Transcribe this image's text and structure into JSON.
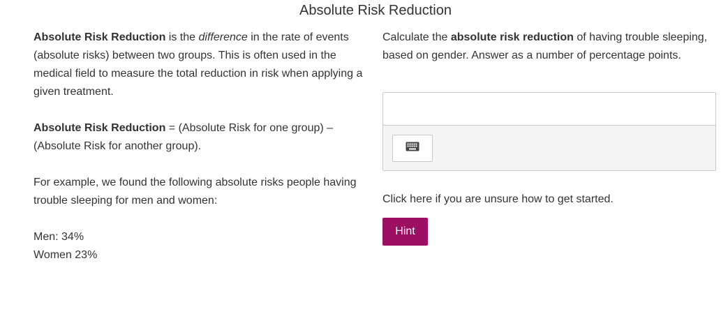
{
  "page": {
    "title": "Absolute Risk Reduction"
  },
  "left": {
    "p1": {
      "term": "Absolute Risk Reduction",
      "t1": " is the ",
      "em": "difference",
      "t2": " in the rate of events (absolute risks) between two groups. This is often used in the medical field to measure the total reduction in risk when applying a given treatment."
    },
    "p2": {
      "term": "Absolute Risk Reduction",
      "formula": " = (Absolute Risk for one group) – (Absolute Risk for another group)."
    },
    "p3": "For example, we found the following absolute risks people having trouble sleeping for men and women:",
    "risks": [
      "Men: 34%",
      "Women 23%"
    ]
  },
  "question": {
    "t1": "Calculate the ",
    "bold": "absolute risk reduction",
    "t2": " of having trouble sleeping, based on gender. Answer as a number of percentage points."
  },
  "answer": {
    "value": "",
    "keyboard_icon": "keyboard-icon"
  },
  "helper": {
    "text": "Click here if you are unsure how to get started."
  },
  "hint": {
    "label": "Hint",
    "color": "#9c0f63"
  }
}
